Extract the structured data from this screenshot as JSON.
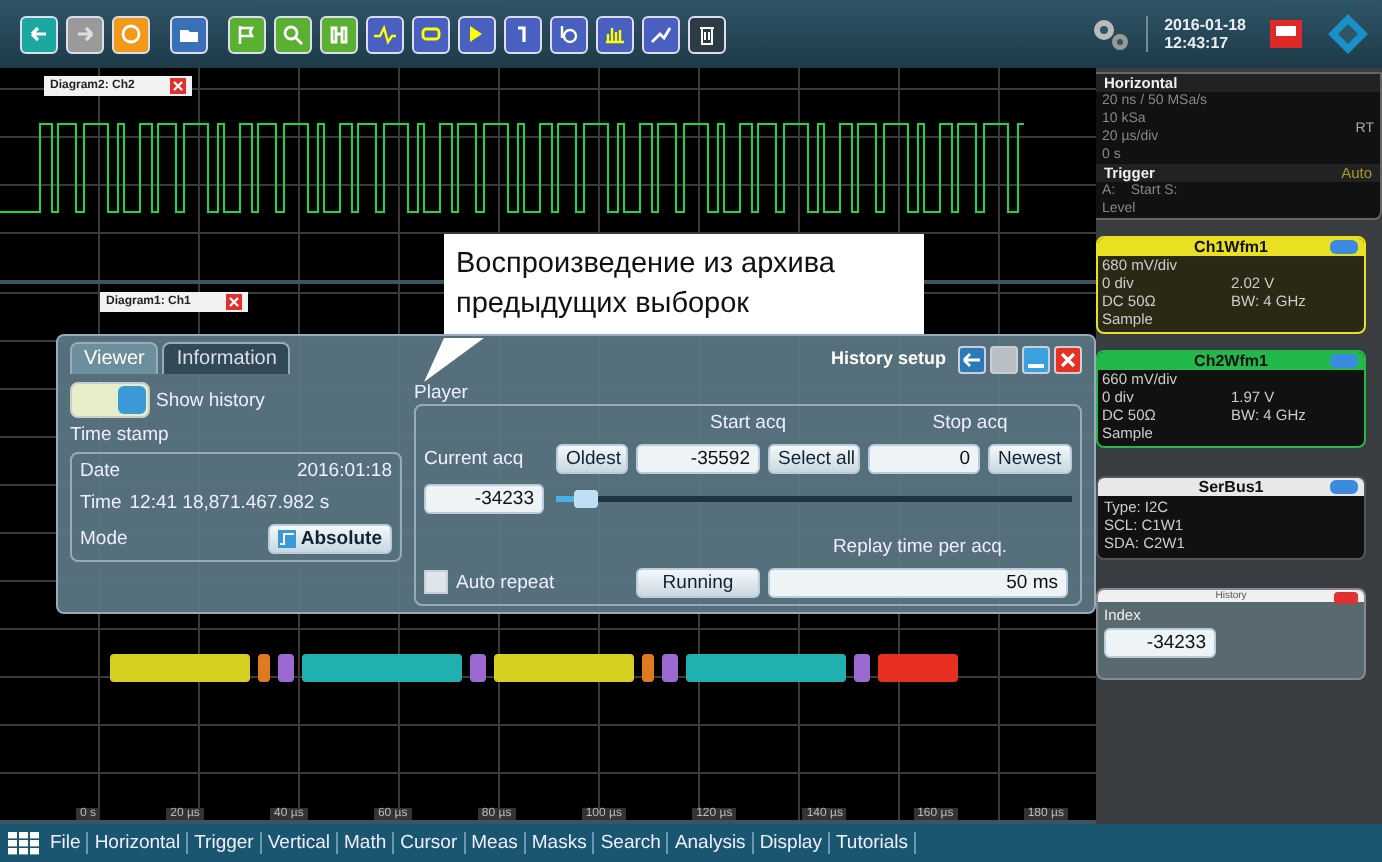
{
  "toolbar": {
    "date": "2016-01-18",
    "time": "12:43:17"
  },
  "diagrams": [
    {
      "title": "Diagram2: Ch2"
    },
    {
      "title": "Diagram1: Ch1"
    }
  ],
  "callout": {
    "text": "Воспроизведение из архива\nпредыдущих выборок"
  },
  "dialog": {
    "tabs": [
      {
        "label": "Viewer",
        "selected": true
      },
      {
        "label": "Information",
        "selected": false
      }
    ],
    "title": "History setup",
    "show_history": {
      "label": "Show history",
      "on": true
    },
    "time_stamp": {
      "heading": "Time stamp",
      "date_label": "Date",
      "date": "2016:01:18",
      "time_label": "Time",
      "time": "12:41 18,871.467.982 s",
      "mode_label": "Mode",
      "mode": "Absolute"
    },
    "player": {
      "heading": "Player",
      "start_label": "Start acq",
      "stop_label": "Stop acq",
      "current_label": "Current acq",
      "oldest": "Oldest",
      "start_value": "-35592",
      "select_all": "Select all",
      "stop_value": "0",
      "newest": "Newest",
      "current_value": "-34233",
      "position": {
        "level": 0.06
      },
      "auto_repeat": {
        "label": "Auto repeat",
        "checked": false
      },
      "running": "Running",
      "replay_label": "Replay time per acq.",
      "replay_value": "50 ms"
    }
  },
  "time_axis": [
    "0 s",
    "20 µs",
    "40 µs",
    "60 µs",
    "80 µs",
    "100 µs",
    "120 µs",
    "140 µs",
    "160 µs",
    "180 µs"
  ],
  "side_panel": {
    "horizontal": {
      "title": "Horizontal",
      "lines": [
        "20 ns / 50 MSa/s",
        "10 kSa",
        "20 µs/div",
        "0 s"
      ],
      "mode": "RT",
      "trigger_title": "Trigger",
      "trigger_mode": "Auto",
      "trigger_lines": [
        "A:    Start S:",
        "Level"
      ]
    },
    "channels": [
      {
        "title": "Ch1Wfm1",
        "color": "#e8e020",
        "scale": "680 mV/div",
        "offset": "0 div",
        "volts": "2.02 V",
        "coupling": "DC 50Ω",
        "bw": "BW: 4 GHz",
        "mode": "Sample"
      },
      {
        "title": "Ch2Wfm1",
        "color": "#22b84a",
        "scale": "660 mV/div",
        "offset": "0 div",
        "volts": "1.97 V",
        "coupling": "DC 50Ω",
        "bw": "BW: 4 GHz",
        "mode": "Sample"
      }
    ],
    "serbus": {
      "title": "SerBus1",
      "lines": [
        "Type: I2C",
        "SCL: C1W1",
        "SDA: C2W1"
      ]
    },
    "history": {
      "title": "History",
      "label": "Index",
      "value": "-34233"
    }
  },
  "menu": [
    "File",
    "Horizontal",
    "Trigger",
    "Vertical",
    "Math",
    "Cursor",
    "Meas",
    "Masks",
    "Search",
    "Analysis",
    "Display",
    "Tutorials"
  ]
}
